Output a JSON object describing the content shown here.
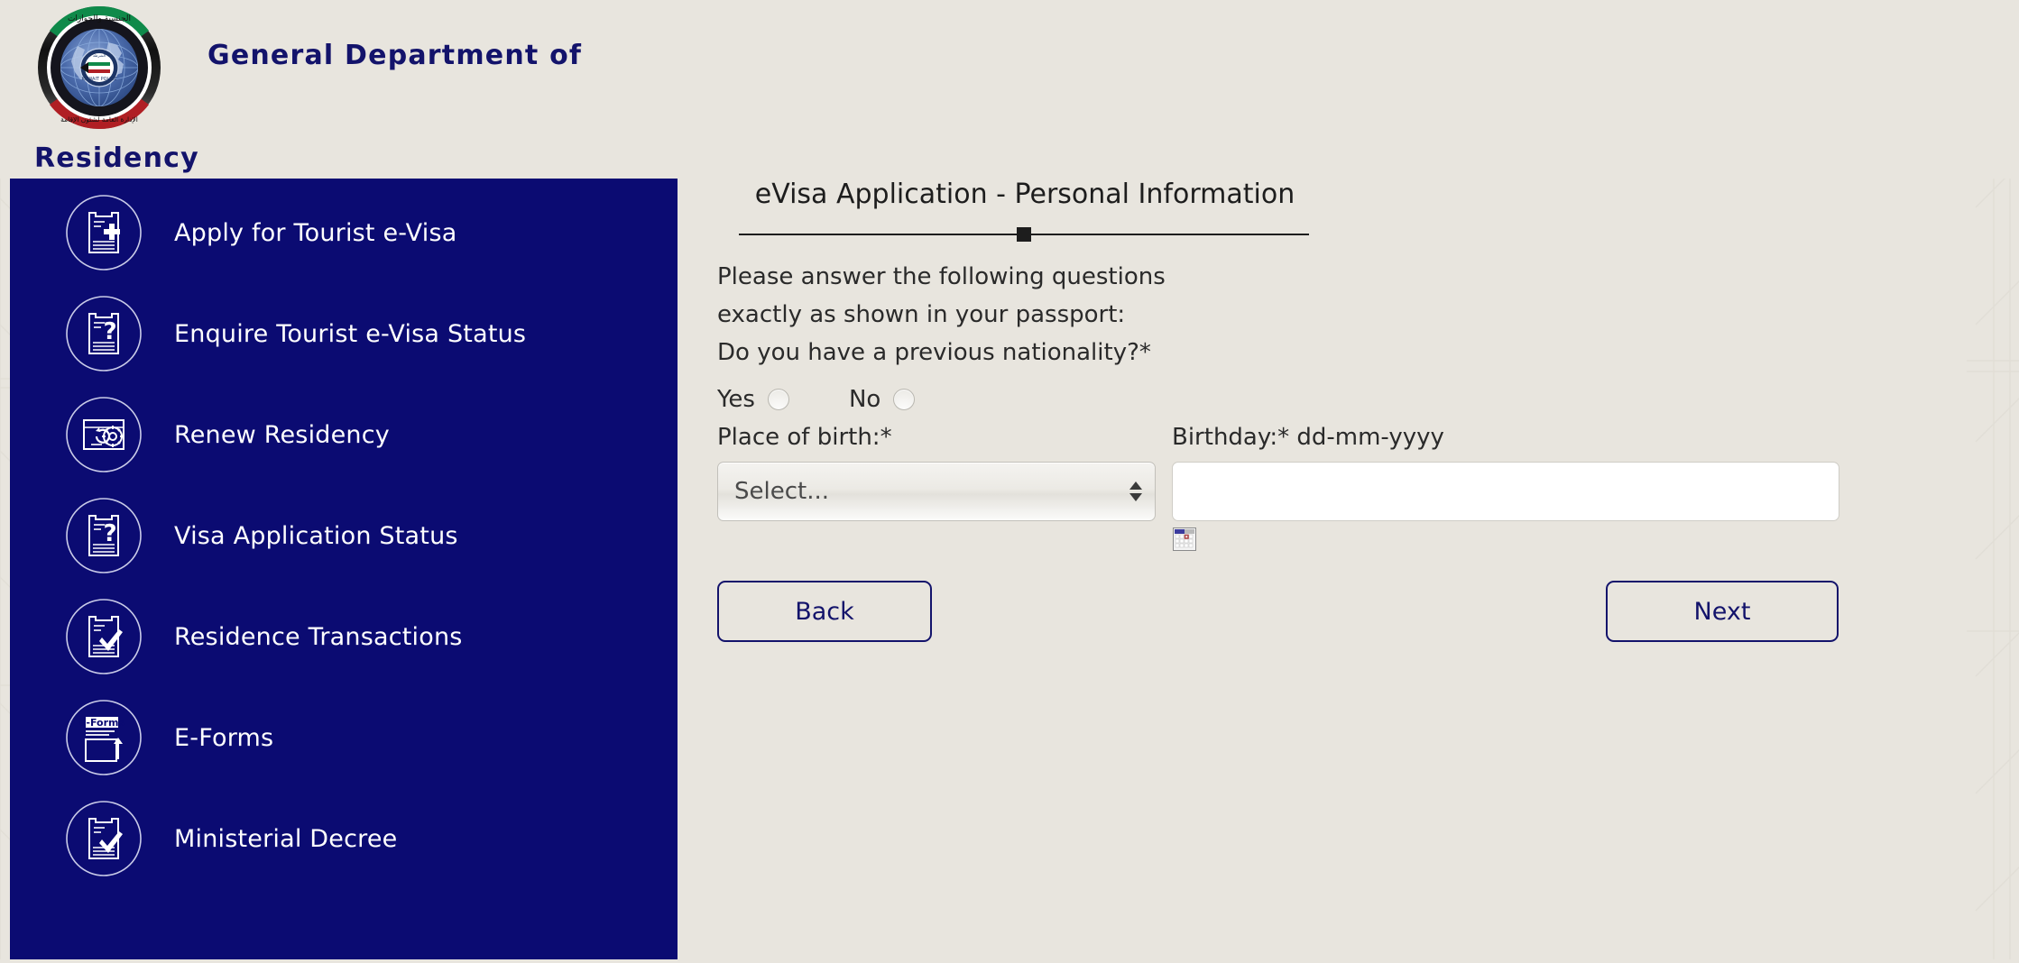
{
  "header": {
    "logo_alt": "kuwait-residency-emblem",
    "brand_line1": "General Department of",
    "brand_line2": "Residency"
  },
  "sidebar": {
    "background_color": "#0b0b72",
    "items": [
      {
        "label": "Apply for Tourist e-Visa",
        "icon": "document-plus-icon"
      },
      {
        "label": "Enquire Tourist e-Visa Status",
        "icon": "document-question-icon"
      },
      {
        "label": "Renew Residency",
        "icon": "card-refresh-gear-icon"
      },
      {
        "label": "Visa Application Status",
        "icon": "document-question-icon"
      },
      {
        "label": "Residence Transactions",
        "icon": "document-check-icon"
      },
      {
        "label": "E-Forms",
        "icon": "e-forms-upload-icon"
      },
      {
        "label": "Ministerial Decree",
        "icon": "document-check-icon"
      }
    ]
  },
  "main": {
    "page_title": "eVisa Application - Personal Information",
    "progress_percent": 50,
    "intro_line1": "Please answer the following questions",
    "intro_line2": "exactly as shown in your passport:",
    "question_nationality": "Do you have a previous nationality?*",
    "radio_yes_label": "Yes",
    "radio_no_label": "No",
    "radio_selected": "",
    "place_of_birth": {
      "label": "Place of birth:*",
      "selected_value": "Select...",
      "options": [
        "Select..."
      ]
    },
    "birthday": {
      "label": "Birthday:* dd-mm-yyyy",
      "value": "",
      "placeholder": "",
      "calendar_icon": "calendar-picker-icon"
    },
    "back_button": "Back",
    "next_button": "Next"
  },
  "colors": {
    "page_background": "#e8e5de",
    "sidebar_navy": "#0b0b72",
    "brand_navy": "#13136b",
    "text_dark": "#2a2a2a"
  }
}
